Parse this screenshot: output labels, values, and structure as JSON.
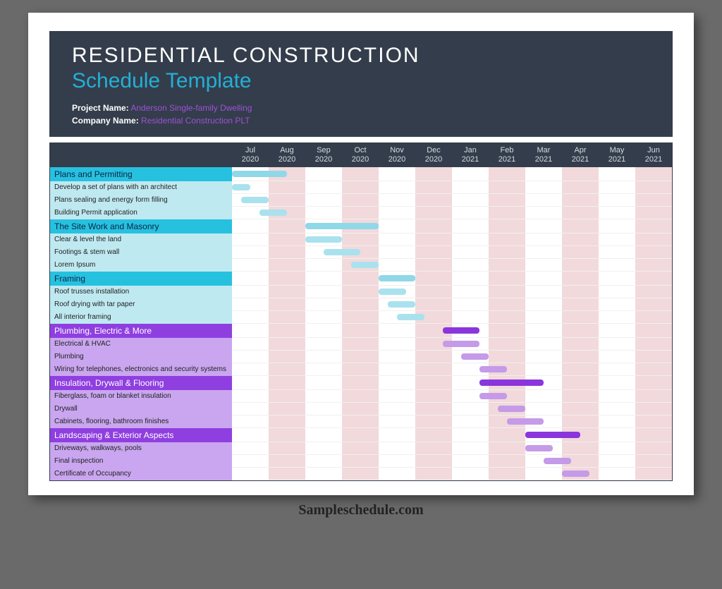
{
  "header": {
    "title_line1": "RESIDENTIAL CONSTRUCTION",
    "title_line2": "Schedule Template",
    "project_label": "Project Name:",
    "project_value": "Anderson Single-family Dwelling",
    "company_label": "Company Name:",
    "company_value": "Residential Construction PLT"
  },
  "timeline": {
    "months": [
      {
        "m": "Jul",
        "y": "2020"
      },
      {
        "m": "Aug",
        "y": "2020"
      },
      {
        "m": "Sep",
        "y": "2020"
      },
      {
        "m": "Oct",
        "y": "2020"
      },
      {
        "m": "Nov",
        "y": "2020"
      },
      {
        "m": "Dec",
        "y": "2020"
      },
      {
        "m": "Jan",
        "y": "2021"
      },
      {
        "m": "Feb",
        "y": "2021"
      },
      {
        "m": "Mar",
        "y": "2021"
      },
      {
        "m": "Apr",
        "y": "2021"
      },
      {
        "m": "May",
        "y": "2021"
      },
      {
        "m": "Jun",
        "y": "2021"
      }
    ]
  },
  "chart_data": {
    "type": "bar",
    "timeline_start": "2020-07",
    "timeline_end": "2021-06",
    "units_per_month": 4,
    "sections": [
      {
        "name": "Plans and Permitting",
        "color_group": "cyan",
        "bar": {
          "start": 1,
          "span": 6
        },
        "tasks": [
          {
            "name": "Develop a set of plans with an architect",
            "bar": {
              "start": 1,
              "span": 2
            }
          },
          {
            "name": "Plans sealing and energy form filling",
            "bar": {
              "start": 2,
              "span": 3
            }
          },
          {
            "name": "Building Permit application",
            "bar": {
              "start": 4,
              "span": 3
            }
          }
        ]
      },
      {
        "name": "The Site Work and Masonry",
        "color_group": "cyan",
        "bar": {
          "start": 9,
          "span": 8
        },
        "tasks": [
          {
            "name": "Clear & level the land",
            "bar": {
              "start": 9,
              "span": 4
            }
          },
          {
            "name": "Footings & stem wall",
            "bar": {
              "start": 11,
              "span": 4
            }
          },
          {
            "name": "Lorem Ipsum",
            "bar": {
              "start": 14,
              "span": 3
            }
          }
        ]
      },
      {
        "name": "Framing",
        "color_group": "cyan",
        "bar": {
          "start": 17,
          "span": 4
        },
        "tasks": [
          {
            "name": "Roof trusses installation",
            "bar": {
              "start": 17,
              "span": 3
            }
          },
          {
            "name": "Roof drying with tar paper",
            "bar": {
              "start": 18,
              "span": 3
            }
          },
          {
            "name": "All interior framing",
            "bar": {
              "start": 19,
              "span": 3
            }
          }
        ]
      },
      {
        "name": "Plumbing, Electric & More",
        "color_group": "purple",
        "bar": {
          "start": 24,
          "span": 4
        },
        "tasks": [
          {
            "name": "Electrical & HVAC",
            "bar": {
              "start": 24,
              "span": 4
            }
          },
          {
            "name": "Plumbing",
            "bar": {
              "start": 26,
              "span": 3
            }
          },
          {
            "name": "Wiring for telephones, electronics and security systems",
            "bar": {
              "start": 28,
              "span": 3
            }
          }
        ]
      },
      {
        "name": "Insulation, Drywall & Flooring",
        "color_group": "purple",
        "bar": {
          "start": 28,
          "span": 7
        },
        "tasks": [
          {
            "name": "Fiberglass, foam or blanket insulation",
            "bar": {
              "start": 28,
              "span": 3
            }
          },
          {
            "name": "Drywall",
            "bar": {
              "start": 30,
              "span": 3
            }
          },
          {
            "name": "Cabinets, flooring, bathroom finishes",
            "bar": {
              "start": 31,
              "span": 4
            }
          }
        ]
      },
      {
        "name": "Landscaping & Exterior Aspects",
        "color_group": "purple",
        "bar": {
          "start": 33,
          "span": 6
        },
        "tasks": [
          {
            "name": "Driveways, walkways, pools",
            "bar": {
              "start": 33,
              "span": 3
            }
          },
          {
            "name": "Final inspection",
            "bar": {
              "start": 35,
              "span": 3
            }
          },
          {
            "name": "Certificate of Occupancy",
            "bar": {
              "start": 37,
              "span": 3
            }
          }
        ]
      }
    ]
  },
  "watermark": "Sampleschedule.com"
}
